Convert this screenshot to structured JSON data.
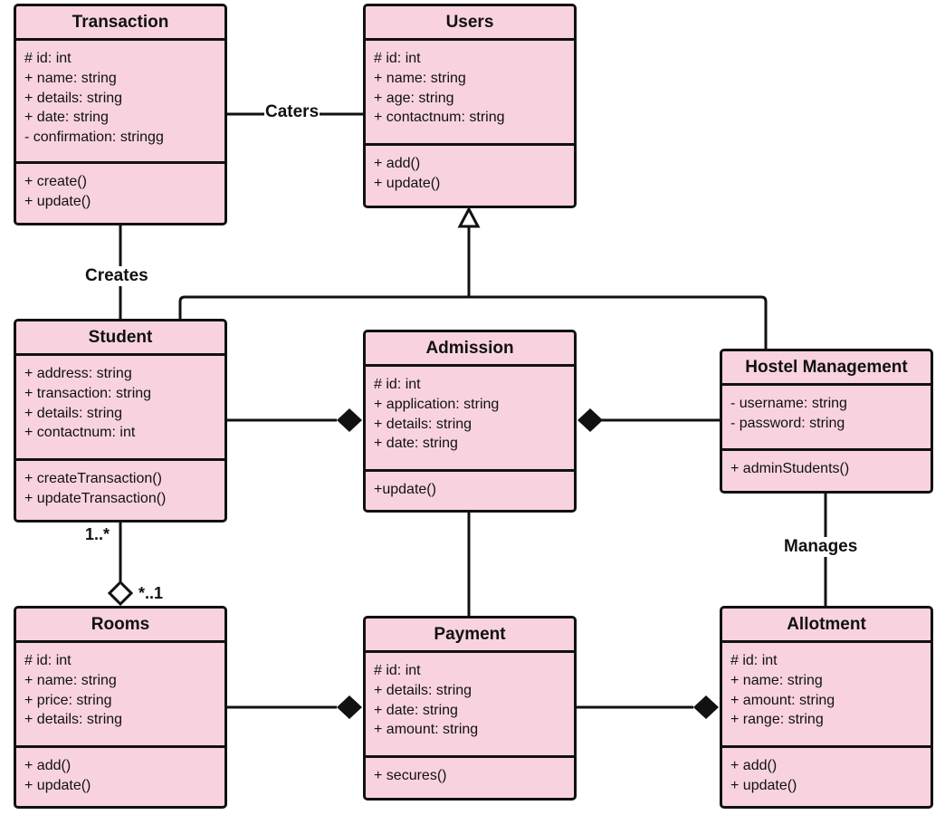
{
  "diagram": {
    "type": "uml-class-diagram",
    "colors": {
      "class_fill": "#f8d3df",
      "stroke": "#111111",
      "background": "#ffffff"
    },
    "classes": {
      "transaction": {
        "name": "Transaction",
        "attributes": [
          "# id: int",
          "+ name: string",
          "+ details: string",
          "+ date: string",
          "- confirmation: stringg"
        ],
        "operations": [
          "+ create()",
          "+ update()"
        ]
      },
      "users": {
        "name": "Users",
        "attributes": [
          "# id: int",
          "+ name: string",
          "+ age: string",
          "+ contactnum: string"
        ],
        "operations": [
          "+ add()",
          "+ update()"
        ]
      },
      "student": {
        "name": "Student",
        "attributes": [
          "+ address: string",
          "+ transaction: string",
          "+ details: string",
          "+ contactnum: int"
        ],
        "operations": [
          "+ createTransaction()",
          "+ updateTransaction()"
        ]
      },
      "admission": {
        "name": "Admission",
        "attributes": [
          "# id: int",
          "+ application: string",
          "+ details: string",
          "+ date: string"
        ],
        "operations": [
          "+update()"
        ]
      },
      "hostel_management": {
        "name": "Hostel Management",
        "attributes": [
          "- username: string",
          "- password: string"
        ],
        "operations": [
          "+ adminStudents()"
        ]
      },
      "rooms": {
        "name": "Rooms",
        "attributes": [
          "# id: int",
          "+ name: string",
          "+ price: string",
          "+ details: string"
        ],
        "operations": [
          "+ add()",
          "+ update()"
        ]
      },
      "payment": {
        "name": "Payment",
        "attributes": [
          "# id: int",
          "+ details: string",
          "+ date: string",
          "+ amount: string"
        ],
        "operations": [
          "+ secures()"
        ]
      },
      "allotment": {
        "name": "Allotment",
        "attributes": [
          "# id: int",
          "+ name: string",
          "+ amount: string",
          "+ range: string"
        ],
        "operations": [
          "+ add()",
          "+ update()"
        ]
      }
    },
    "relationships": {
      "caters": {
        "label": "Caters",
        "from": "Transaction",
        "to": "Users",
        "kind": "association"
      },
      "creates": {
        "label": "Creates",
        "from": "Transaction",
        "to": "Student",
        "kind": "association"
      },
      "generalization": {
        "children": [
          "Student",
          "Hostel Management"
        ],
        "parent": "Users",
        "kind": "generalization"
      },
      "student_admission": {
        "from": "Student",
        "to": "Admission",
        "kind": "composition"
      },
      "hostel_admission": {
        "from": "Hostel Management",
        "to": "Admission",
        "kind": "composition"
      },
      "manages": {
        "label": "Manages",
        "from": "Hostel Management",
        "to": "Allotment",
        "kind": "association"
      },
      "admission_payment": {
        "from": "Admission",
        "to": "Payment",
        "kind": "association"
      },
      "student_rooms": {
        "from": "Rooms",
        "to": "Student",
        "kind": "aggregation",
        "multiplicity_student": "1..*",
        "multiplicity_rooms": "*..1"
      },
      "rooms_payment": {
        "from": "Rooms",
        "to": "Payment",
        "kind": "composition"
      },
      "payment_allotment": {
        "from": "Payment",
        "to": "Allotment",
        "kind": "composition"
      }
    }
  }
}
